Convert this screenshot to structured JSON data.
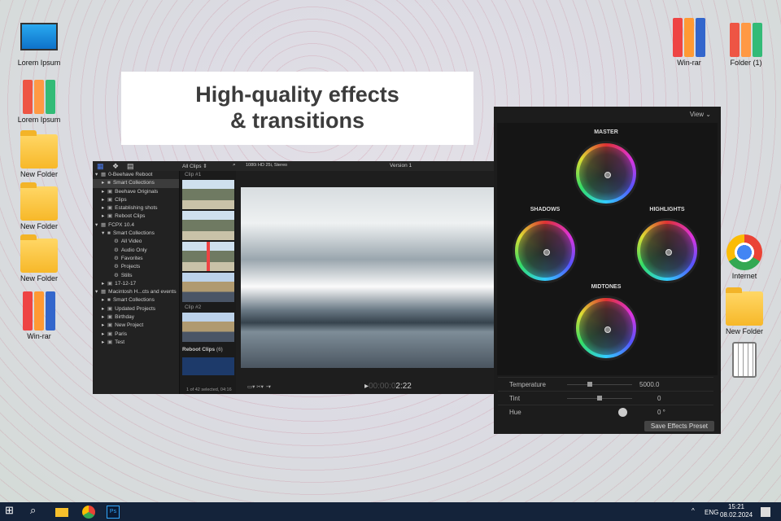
{
  "desktop": {
    "left_icons": [
      "Lorem Ipsum",
      "Lorem Ipsum",
      "New Folder",
      "New Folder",
      "New Folder",
      "Win-rar"
    ],
    "right_icons": [
      "Win-rar",
      "Folder (1)",
      "Internet",
      "New Folder"
    ]
  },
  "banner": {
    "line1": "High-quality effects",
    "line2": "& transitions"
  },
  "fcp": {
    "all_clips": "All Clips ⇕",
    "format": "1080i HD 25i, Stereo",
    "version": "Version 1",
    "library": [
      {
        "label": "0-Beehave Reboot",
        "lvl": 0,
        "arrow": "▾",
        "icon": "▦"
      },
      {
        "label": "Smart Collections",
        "lvl": 1,
        "arrow": "▸",
        "icon": "■",
        "sel": true
      },
      {
        "label": "Beehave Originals",
        "lvl": 1,
        "arrow": "▸",
        "icon": "▣"
      },
      {
        "label": "Clips",
        "lvl": 1,
        "arrow": "▸",
        "icon": "▣"
      },
      {
        "label": "Establishing shots",
        "lvl": 1,
        "arrow": "▸",
        "icon": "▣"
      },
      {
        "label": "Reboot Clips",
        "lvl": 1,
        "arrow": "▸",
        "icon": "▣"
      },
      {
        "label": "FCPX 10.4",
        "lvl": 0,
        "arrow": "▾",
        "icon": "▦"
      },
      {
        "label": "Smart Collections",
        "lvl": 1,
        "arrow": "▾",
        "icon": "■"
      },
      {
        "label": "All Video",
        "lvl": 2,
        "arrow": "",
        "icon": "⚙"
      },
      {
        "label": "Audio Only",
        "lvl": 2,
        "arrow": "",
        "icon": "⚙"
      },
      {
        "label": "Favorites",
        "lvl": 2,
        "arrow": "",
        "icon": "⚙"
      },
      {
        "label": "Projects",
        "lvl": 2,
        "arrow": "",
        "icon": "⚙"
      },
      {
        "label": "Stills",
        "lvl": 2,
        "arrow": "",
        "icon": "⚙"
      },
      {
        "label": "17-12-17",
        "lvl": 1,
        "arrow": "▸",
        "icon": "▣"
      },
      {
        "label": "Macintosh H...cts and events",
        "lvl": 0,
        "arrow": "▾",
        "icon": "▦"
      },
      {
        "label": "Smart Collections",
        "lvl": 1,
        "arrow": "▸",
        "icon": "■"
      },
      {
        "label": "Updated Projects",
        "lvl": 1,
        "arrow": "▸",
        "icon": "▣"
      },
      {
        "label": "Birthday",
        "lvl": 1,
        "arrow": "▸",
        "icon": "▣"
      },
      {
        "label": "New Project",
        "lvl": 1,
        "arrow": "▸",
        "icon": "▣"
      },
      {
        "label": "Paris",
        "lvl": 1,
        "arrow": "▸",
        "icon": "▣"
      },
      {
        "label": "Test",
        "lvl": 1,
        "arrow": "▸",
        "icon": "▣"
      }
    ],
    "clip1": "Clip #1",
    "clip2": "Clip #2",
    "reboot_clips": "Reboot Clips",
    "reboot_count": "(6)",
    "status": "1 of 42 selected, 04:16",
    "timecode_dim": "00:00:0",
    "timecode": "2:22"
  },
  "color": {
    "view": "View",
    "master": "MASTER",
    "shadows": "SHADOWS",
    "highlights": "HIGHLIGHTS",
    "midtones": "MIDTONES",
    "params": [
      {
        "label": "Temperature",
        "value": "5000.0",
        "pos": 0.35
      },
      {
        "label": "Tint",
        "value": "0",
        "pos": 0.5
      },
      {
        "label": "Hue",
        "value": "0 °"
      }
    ],
    "save": "Save Effects Preset"
  },
  "taskbar": {
    "lang": "ENG",
    "time": "15:21",
    "date": "08.02.2024"
  }
}
